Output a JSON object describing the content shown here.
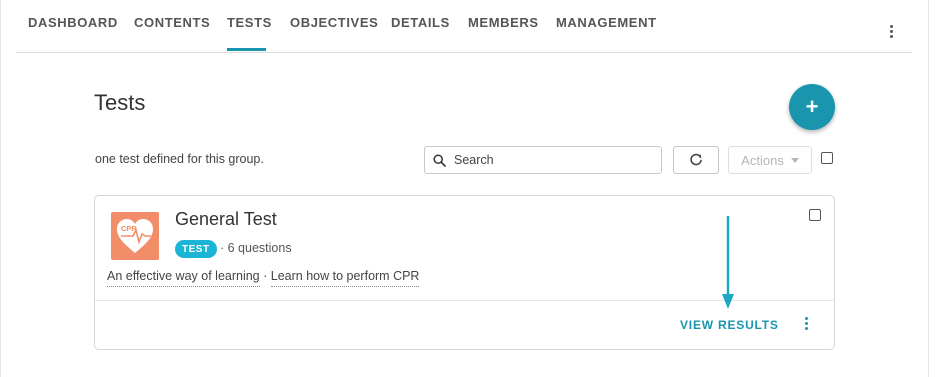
{
  "nav": {
    "tabs": [
      {
        "label": "DASHBOARD"
      },
      {
        "label": "CONTENTS"
      },
      {
        "label": "TESTS"
      },
      {
        "label": "OBJECTIVES"
      },
      {
        "label": "DETAILS"
      },
      {
        "label": "MEMBERS"
      },
      {
        "label": "MANAGEMENT"
      }
    ],
    "active_tab": "TESTS",
    "more_icon": "kebab-vertical-icon"
  },
  "page": {
    "title": "Tests",
    "add_icon": "plus-icon",
    "add_label": "+",
    "count_text": "one test defined for this group."
  },
  "toolbar": {
    "search_placeholder": "Search",
    "search_value": "",
    "refresh_icon": "refresh-icon",
    "actions_label": "Actions",
    "select_all_checked": false
  },
  "tests": [
    {
      "icon_text": "CPR",
      "icon_name": "cpr-heart-icon",
      "title": "General Test",
      "badge": "TEST",
      "question_count": "· 6 questions",
      "category": "An effective way of learning",
      "separator": "·",
      "objective": "Learn how to perform CPR",
      "view_results_label": "VIEW RESULTS",
      "checked": false
    }
  ],
  "colors": {
    "accent": "#1996ad",
    "badge": "#1db5d6",
    "icon_bg": "#f28d69",
    "disabled_text": "#b5b5b5"
  }
}
